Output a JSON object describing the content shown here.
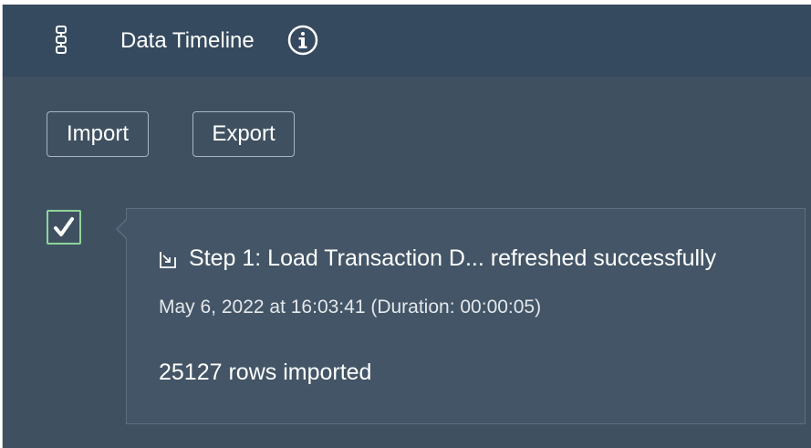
{
  "header": {
    "title": "Data Timeline",
    "timeline_icon": "timeline-icon",
    "info_icon": "info-icon"
  },
  "toolbar": {
    "import_label": "Import",
    "export_label": "Export"
  },
  "timeline": {
    "entries": [
      {
        "status": "success",
        "status_icon": "checkmark-icon",
        "type_icon": "import-icon",
        "title": "Step 1: Load Transaction D... refreshed successfully",
        "timestamp": "May 6, 2022 at 16:03:41 (Duration: 00:00:05)",
        "detail": "25127 rows imported"
      }
    ]
  },
  "colors": {
    "header_bg": "#354a5f",
    "panel_bg": "#3f5161",
    "card_bg": "#435566",
    "success": "#8fd49a",
    "text": "#ffffff"
  }
}
